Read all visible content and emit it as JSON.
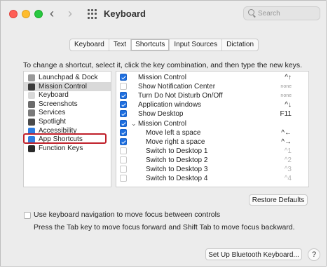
{
  "window": {
    "title": "Keyboard"
  },
  "search": {
    "placeholder": "Search"
  },
  "tabs": [
    {
      "label": "Keyboard",
      "active": false
    },
    {
      "label": "Text",
      "active": false
    },
    {
      "label": "Shortcuts",
      "active": true
    },
    {
      "label": "Input Sources",
      "active": false
    },
    {
      "label": "Dictation",
      "active": false
    }
  ],
  "instruction": "To change a shortcut, select it, click the key combination, and then type the new keys.",
  "categories": [
    {
      "label": "Launchpad & Dock",
      "icon": "launchpad-icon",
      "color": "#9a9a9a"
    },
    {
      "label": "Mission Control",
      "icon": "mission-control-icon",
      "color": "#3a3a3a",
      "selected": true
    },
    {
      "label": "Keyboard",
      "icon": "keyboard-icon",
      "color": "#d8d8d8"
    },
    {
      "label": "Screenshots",
      "icon": "screenshots-icon",
      "color": "#6b6b6b"
    },
    {
      "label": "Services",
      "icon": "services-icon",
      "color": "#7a7a7a"
    },
    {
      "label": "Spotlight",
      "icon": "spotlight-icon",
      "color": "#4a4a4a"
    },
    {
      "label": "Accessibility",
      "icon": "accessibility-icon",
      "color": "#2f7de1"
    },
    {
      "label": "App Shortcuts",
      "icon": "app-shortcuts-icon",
      "color": "#2f7de1",
      "highlighted": true
    },
    {
      "label": "Function Keys",
      "icon": "function-keys-icon",
      "color": "#2a2a2a"
    }
  ],
  "shortcuts": [
    {
      "checked": true,
      "name": "Mission Control",
      "key": "^↑",
      "indent": false
    },
    {
      "checked": false,
      "name": "Show Notification Center",
      "key": "none",
      "indent": false
    },
    {
      "checked": true,
      "name": "Turn Do Not Disturb On/Off",
      "key": "none",
      "indent": false
    },
    {
      "checked": true,
      "name": "Application windows",
      "key": "^↓",
      "indent": false
    },
    {
      "checked": true,
      "name": "Show Desktop",
      "key": "F11",
      "indent": false
    },
    {
      "checked": true,
      "name": "Mission Control",
      "key": "",
      "indent": false,
      "group": true
    },
    {
      "checked": true,
      "name": "Move left a space",
      "key": "^←",
      "indent": true
    },
    {
      "checked": true,
      "name": "Move right a space",
      "key": "^→",
      "indent": true
    },
    {
      "checked": false,
      "name": "Switch to Desktop 1",
      "key": "^1",
      "indent": true
    },
    {
      "checked": false,
      "name": "Switch to Desktop 2",
      "key": "^2",
      "indent": true
    },
    {
      "checked": false,
      "name": "Switch to Desktop 3",
      "key": "^3",
      "indent": true
    },
    {
      "checked": false,
      "name": "Switch to Desktop 4",
      "key": "^4",
      "indent": true
    }
  ],
  "restore_defaults_label": "Restore Defaults",
  "keyboard_navigation": {
    "checked": false,
    "label": "Use keyboard navigation to move focus between controls",
    "hint": "Press the Tab key to move focus forward and Shift Tab to move focus backward."
  },
  "bluetooth_button_label": "Set Up Bluetooth Keyboard...",
  "help_label": "?"
}
